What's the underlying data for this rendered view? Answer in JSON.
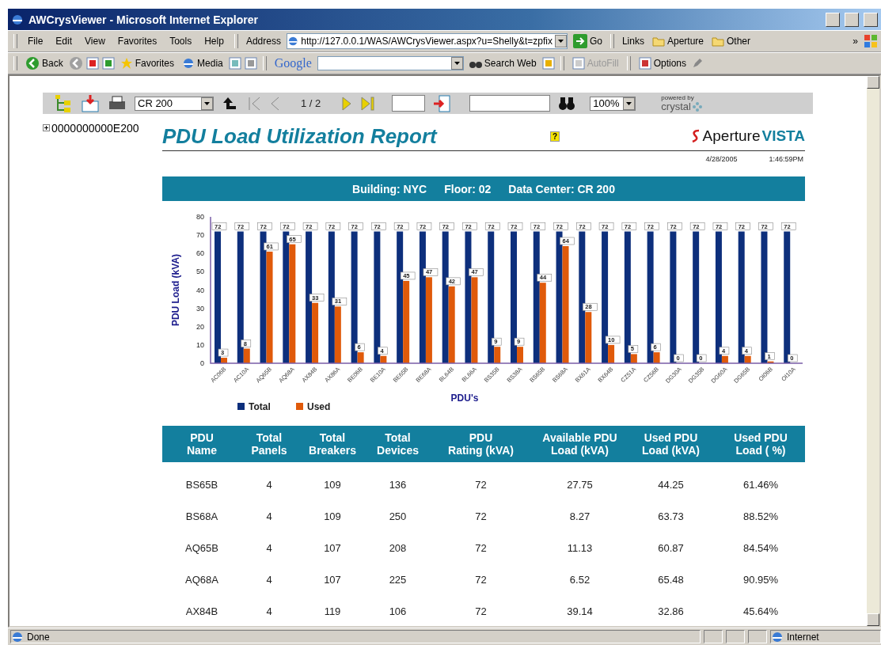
{
  "window": {
    "title": "AWCrysViewer - Microsoft Internet Explorer"
  },
  "menu": [
    {
      "label": "File"
    },
    {
      "label": "Edit"
    },
    {
      "label": "View"
    },
    {
      "label": "Favorites"
    },
    {
      "label": "Tools"
    },
    {
      "label": "Help"
    }
  ],
  "address_bar": {
    "label": "Address",
    "url": "http://127.0.0.1/WAS/AWCrysViewer.aspx?u=Shelly&t=zpfix",
    "go": "Go"
  },
  "links_bar": {
    "label": "Links",
    "links": [
      {
        "label": "Aperture"
      },
      {
        "label": "Other"
      }
    ],
    "more": "»"
  },
  "toolbar": {
    "back": "Back",
    "favorites": "Favorites",
    "media": "Media",
    "google": "Google",
    "search": "Search Web",
    "autofill": "AutoFill",
    "options": "Options"
  },
  "report_toolbar": {
    "group": "CR 200",
    "page": "1 / 2",
    "zoom": "100%",
    "powered_by": "powered by",
    "brand": "crystal"
  },
  "tree": [
    {
      "label": "0000000000E200",
      "expanded": false
    }
  ],
  "report": {
    "title": "PDU Load Utilization Report",
    "help": "?",
    "logo": {
      "name": "Aperture",
      "suffix": "VISTA"
    },
    "date": "4/28/2005",
    "time": "1:46:59PM",
    "banner": [
      "Building: NYC",
      "Floor: 02",
      "Data Center: CR 200"
    ],
    "chart_data": {
      "type": "bar",
      "xlabel": "PDU's",
      "ylabel": "PDU Load (kVA)",
      "categories": [
        "AC06B",
        "AC10A",
        "AQ65B",
        "AQ68A",
        "AX84B",
        "AX86A",
        "BE06B",
        "BE10A",
        "BE65B",
        "BE68A",
        "BL64B",
        "BL66A",
        "BS35B",
        "BS38A",
        "BS65B",
        "BS68A",
        "BX61A",
        "BX64B",
        "CZ51A",
        "CZ56B",
        "DG30A",
        "DG35B",
        "DG60A",
        "DG65B",
        "OI06B",
        "OI10A"
      ],
      "series": [
        {
          "name": "Total",
          "color": "#0d2f7c",
          "values": [
            72,
            72,
            72,
            72,
            72,
            72,
            72,
            72,
            72,
            72,
            72,
            72,
            72,
            72,
            72,
            72,
            72,
            72,
            72,
            72,
            72,
            72,
            72,
            72,
            72,
            72
          ]
        },
        {
          "name": "Used",
          "color": "#e05a0a",
          "values": [
            3,
            8,
            61,
            65,
            33,
            31,
            6,
            4,
            45,
            47,
            42,
            47,
            9,
            9,
            44,
            64,
            28,
            10,
            5,
            6,
            0,
            0,
            4,
            4,
            1,
            0
          ]
        }
      ],
      "ylim": [
        0,
        80
      ],
      "yticks": [
        0,
        10,
        20,
        30,
        40,
        50,
        60,
        70,
        80
      ],
      "data_labels": true,
      "legend": true
    },
    "table": {
      "columns": [
        "PDU\nName",
        "Total\nPanels",
        "Total\nBreakers",
        "Total\nDevices",
        "PDU\nRating (kVA)",
        "Available PDU\nLoad (kVA)",
        "Used PDU\nLoad (kVA)",
        "Used PDU\nLoad ( %)"
      ],
      "rows": [
        [
          "BS65B",
          "4",
          "109",
          "136",
          "72",
          "27.75",
          "44.25",
          "61.46%"
        ],
        [
          "BS68A",
          "4",
          "109",
          "250",
          "72",
          "8.27",
          "63.73",
          "88.52%"
        ],
        [
          "AQ65B",
          "4",
          "107",
          "208",
          "72",
          "11.13",
          "60.87",
          "84.54%"
        ],
        [
          "AQ68A",
          "4",
          "107",
          "225",
          "72",
          "6.52",
          "65.48",
          "90.95%"
        ],
        [
          "AX84B",
          "4",
          "119",
          "106",
          "72",
          "39.14",
          "32.86",
          "45.64%"
        ]
      ]
    }
  },
  "status_bar": {
    "text": "Done",
    "zone": "Internet"
  }
}
